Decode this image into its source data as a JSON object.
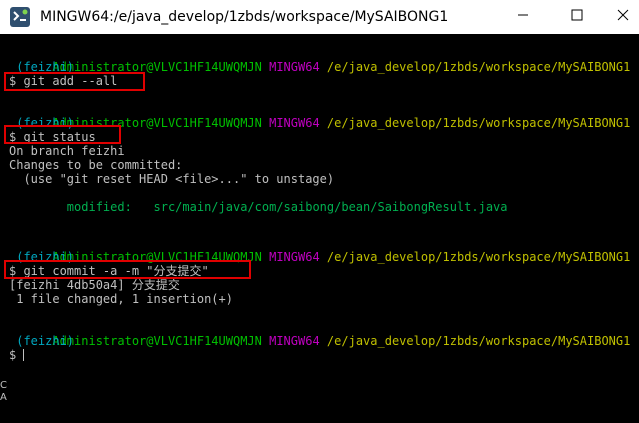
{
  "window": {
    "title": "MINGW64:/e/java_develop/1zbds/workspace/MySAIBONG1"
  },
  "colors": {
    "prompt_user": "#00c000",
    "prompt_shell": "#c000c0",
    "prompt_path": "#c0c000",
    "branch": "#00a8c0",
    "text": "#c0c0c0",
    "highlight_box": "#e00000",
    "background": "#000000"
  },
  "icons": {
    "app": "mingw64-icon",
    "minimize": "minimize-icon",
    "maximize": "maximize-icon",
    "close": "close-icon"
  },
  "terminal": {
    "prompt_user": "Administrator@VLVC1HF14UWQMJN",
    "prompt_shell": "MINGW64",
    "prompt_path": "/e/java_develop/1zbds/workspace/MySAIBONG1",
    "branch": " (feizhi)",
    "cmd1": "$ git add --all",
    "cmd2": "$ git status",
    "status_line1": "On branch feizhi",
    "status_line2": "Changes to be committed:",
    "status_line3": "  (use \"git reset HEAD <file>...\" to unstage)",
    "modified_label": "        modified:",
    "modified_file": "   src/main/java/com/saibong/bean/SaibongResult.java",
    "cmd3": "$ git commit -a -m \"分支提交\"",
    "commit_line1": "[feizhi 4db50a4] 分支提交",
    "commit_line2": " 1 file changed, 1 insertion(+)",
    "prompt_last": "$ "
  }
}
